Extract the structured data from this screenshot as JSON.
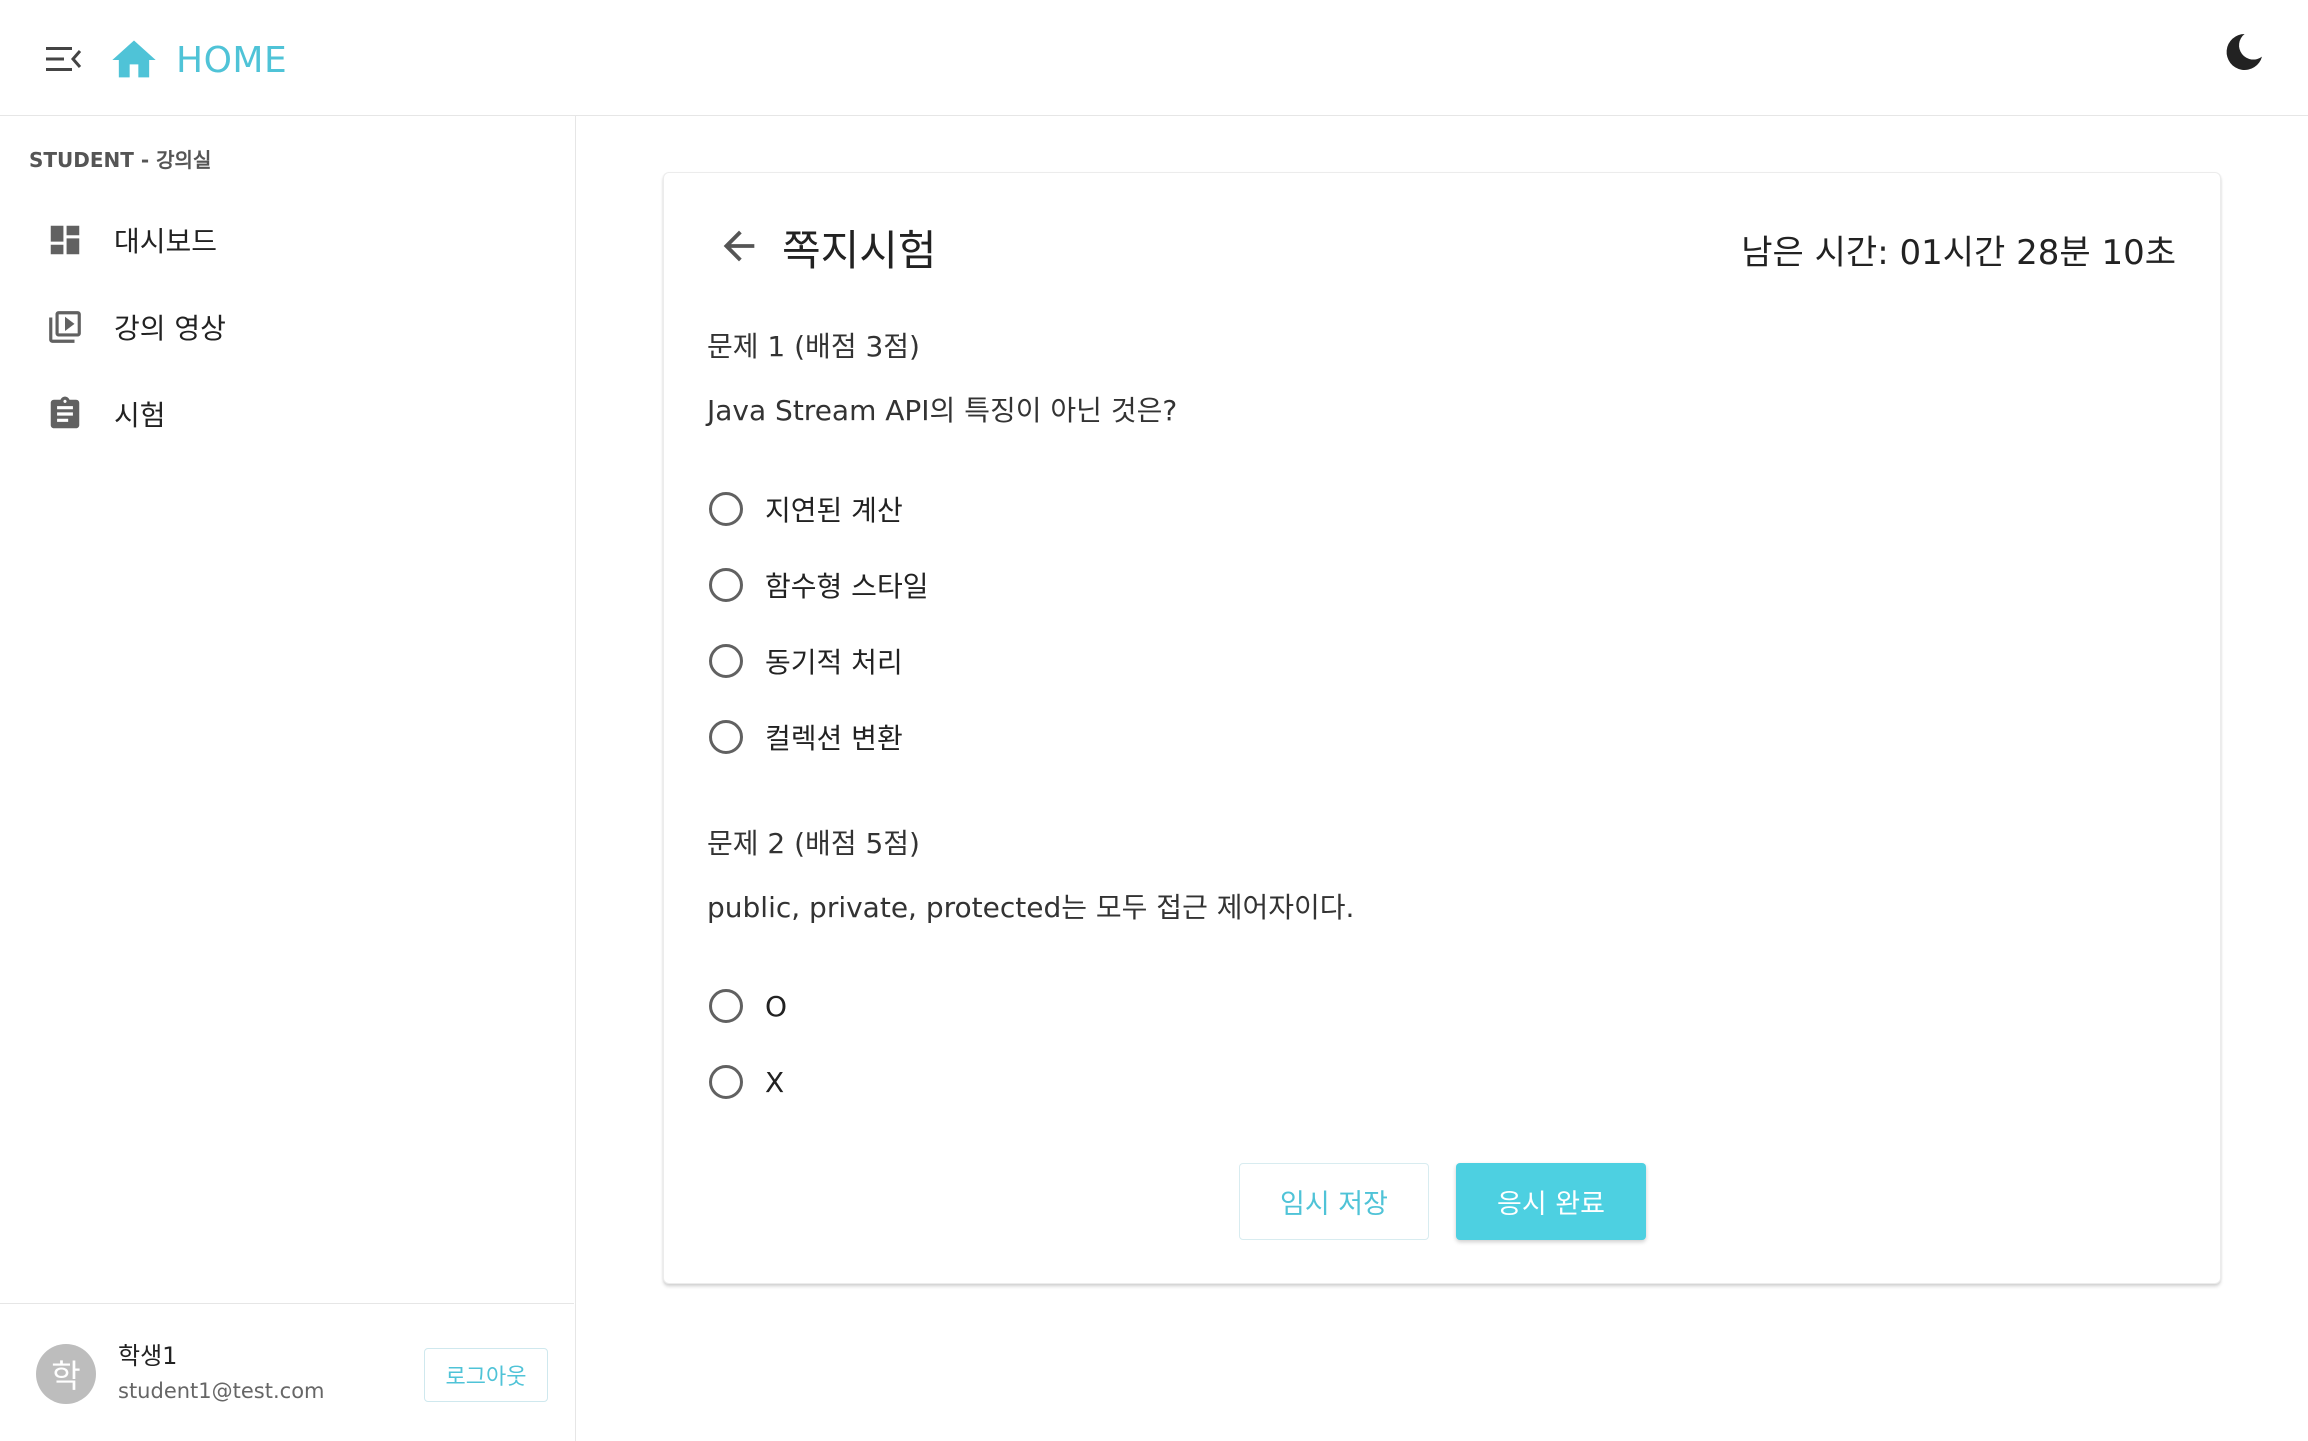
{
  "header": {
    "home_label": "HOME",
    "accent_color": "#4fc3d7"
  },
  "sidebar": {
    "section_title": "STUDENT - 강의실",
    "items": [
      {
        "label": "대시보드",
        "icon": "dashboard-icon"
      },
      {
        "label": "강의 영상",
        "icon": "video-library-icon"
      },
      {
        "label": "시험",
        "icon": "clipboard-icon"
      }
    ],
    "user": {
      "avatar_initial": "학",
      "name": "학생1",
      "email": "student1@test.com",
      "logout_label": "로그아웃"
    }
  },
  "exam": {
    "title": "쪽지시험",
    "timer": "남은 시간: 01시간 28분 10초",
    "questions": [
      {
        "title": "문제 1 (배점 3점)",
        "text": "Java Stream API의 특징이 아닌 것은?",
        "options": [
          "지연된 계산",
          "함수형 스타일",
          "동기적 처리",
          "컬렉션 변환"
        ]
      },
      {
        "title": "문제 2 (배점 5점)",
        "text": "public, private, protected는 모두 접근 제어자이다.",
        "options": [
          "O",
          "X"
        ]
      }
    ],
    "save_label": "임시 저장",
    "submit_label": "응시 완료"
  }
}
